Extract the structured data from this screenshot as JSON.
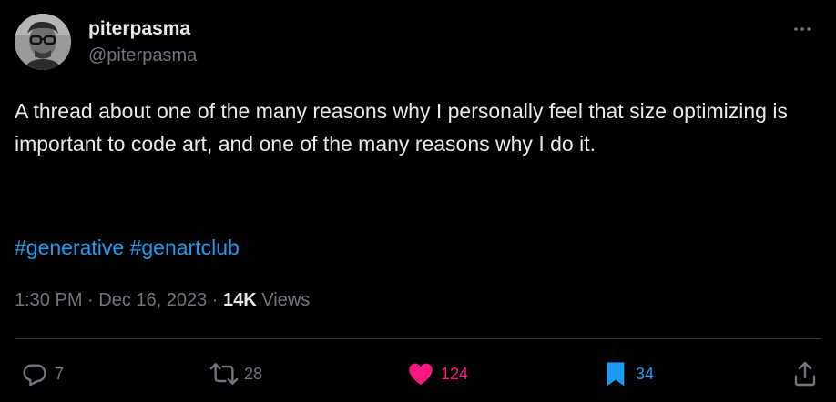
{
  "tweet": {
    "author": {
      "display_name": "piterpasma",
      "handle": "@piterpasma"
    },
    "text": "A thread about one of the many reasons why I personally feel that size optimizing is important to code art, and one of the many reasons why I do it.",
    "hashtags": [
      "#generative",
      "#genartclub"
    ],
    "time": "1:30 PM",
    "separator1": " · ",
    "date": "Dec 16, 2023",
    "separator2": " · ",
    "views_count": "14K",
    "views_label": " Views",
    "stats": {
      "replies": "7",
      "reposts": "28",
      "likes": "124",
      "bookmarks": "34"
    }
  },
  "icons": {
    "more": "more-horizontal-icon",
    "reply": "reply-icon",
    "repost": "repost-icon",
    "like": "heart-icon",
    "bookmark": "bookmark-icon",
    "share": "share-icon"
  },
  "colors": {
    "background": "#000000",
    "text_primary": "#e7e9ea",
    "text_secondary": "#71767b",
    "link": "#1d9bf0",
    "like_active": "#f91880",
    "bookmark_active": "#1d9bf0",
    "divider": "#2f3336"
  }
}
